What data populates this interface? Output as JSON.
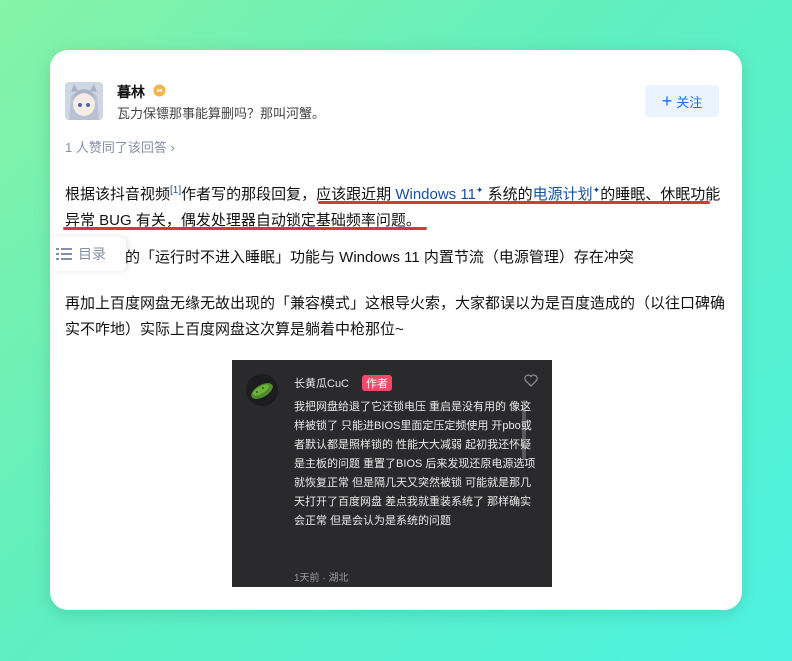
{
  "author": {
    "name": "暮林",
    "bio": "瓦力保镖那事能算删吗？那叫河蟹。"
  },
  "follow_button": {
    "icon": "plus-icon",
    "label": "关注"
  },
  "upvote_line": "1 人赞同了该回答",
  "paragraph1": {
    "t1": "根据该抖音视频",
    "cite": "[1]",
    "t2": "作者写的那段回复，",
    "t3": "应该跟近期 ",
    "link1": "Windows 11",
    "t4": " 系统的",
    "link2": "电源计划",
    "t5": "的睡眠、休眠功能异常 BUG 有关，偶发处理器自动锁定基础频率问题。"
  },
  "paragraph2": "百度网盘的「运行时不进入睡眠」功能与 Windows 11 内置节流（电源管理）存在冲突",
  "paragraph3": "再加上百度网盘无缘无故出现的「兼容模式」这根导火索，大家都误以为是百度造成的（以往口碑确实不咋地）实际上百度网盘这次算是躺着中枪那位~",
  "toc_button": {
    "icon": "list-icon",
    "label": "目录"
  },
  "screenshot": {
    "commenter": "长黄瓜CuC",
    "tag": "作者",
    "text": "我把网盘给退了它还锁电压 重启是没有用的 像这样被锁了 只能进BIOS里面定压定频使用 开pbo或者默认都是照样锁的 性能大大减弱 起初我还怀疑是主板的问题 重置了BIOS 后来发现还原电源选项就恢复正常 但是隔几天又突然被锁 可能就是那几天打开了百度网盘 差点我就重装系统了 那样确实会正常 但是会认为是系统的问题",
    "meta": "1天前 · 湖北"
  },
  "colors": {
    "link": "#175199",
    "accent": "#1772f6",
    "underline": "#d53a3a"
  }
}
